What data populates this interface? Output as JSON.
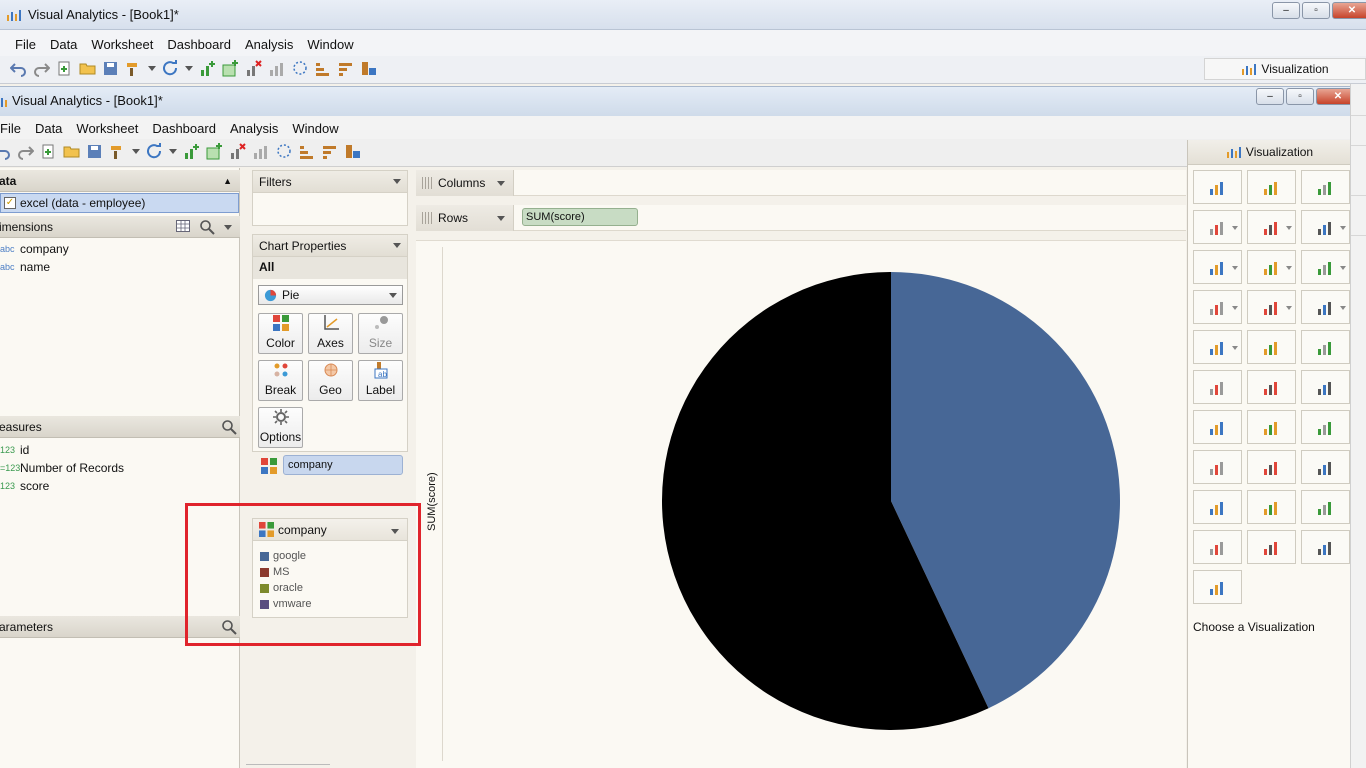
{
  "outer_window": {
    "title": "Visual Analytics - [Book1]*",
    "menu": [
      "File",
      "Data",
      "Worksheet",
      "Dashboard",
      "Analysis",
      "Window"
    ],
    "viz_tab_label": "Visualization"
  },
  "inner_window": {
    "title": "Visual Analytics - [Book1]*",
    "menu": [
      "File",
      "Data",
      "Worksheet",
      "Dashboard",
      "Analysis",
      "Window"
    ]
  },
  "data_panel": {
    "header": "ata",
    "source": "excel (data - employee)",
    "dimensions_header": "imensions",
    "dimensions": [
      {
        "type": "abc",
        "name": "company"
      },
      {
        "type": "abc",
        "name": "name"
      }
    ],
    "measures_header": "easures",
    "measures": [
      {
        "type": "123",
        "name": "id"
      },
      {
        "type": "=123",
        "name": "Number of Records"
      },
      {
        "type": "123",
        "name": "score"
      }
    ],
    "parameters_header": "arameters"
  },
  "filters": {
    "header": "Filters"
  },
  "chart_properties": {
    "header": "Chart Properties",
    "scope": "All",
    "chart_type": "Pie",
    "buttons": [
      "Color",
      "Axes",
      "Size",
      "Break",
      "Geo",
      "Label",
      "Options"
    ],
    "color_field": "company"
  },
  "legend": {
    "title": "company",
    "items": [
      {
        "label": "google",
        "color": "#476796"
      },
      {
        "label": "MS",
        "color": "#8c3a2e"
      },
      {
        "label": "oracle",
        "color": "#7d8a2c"
      },
      {
        "label": "vmware",
        "color": "#5a4d80"
      }
    ]
  },
  "shelves": {
    "columns_label": "Columns",
    "rows_label": "Rows",
    "rows_pill": "SUM(score)"
  },
  "chart_data": {
    "type": "pie",
    "ylabel": "SUM(score)",
    "slices": [
      {
        "value": 43,
        "color": "#476796"
      },
      {
        "value": 57,
        "color": "#000000"
      }
    ]
  },
  "visualization_panel": {
    "header": "Visualization",
    "prompt": "Choose a Visualization"
  },
  "colors": {
    "accent_blue": "#476796",
    "highlight_red": "#e0242c"
  }
}
